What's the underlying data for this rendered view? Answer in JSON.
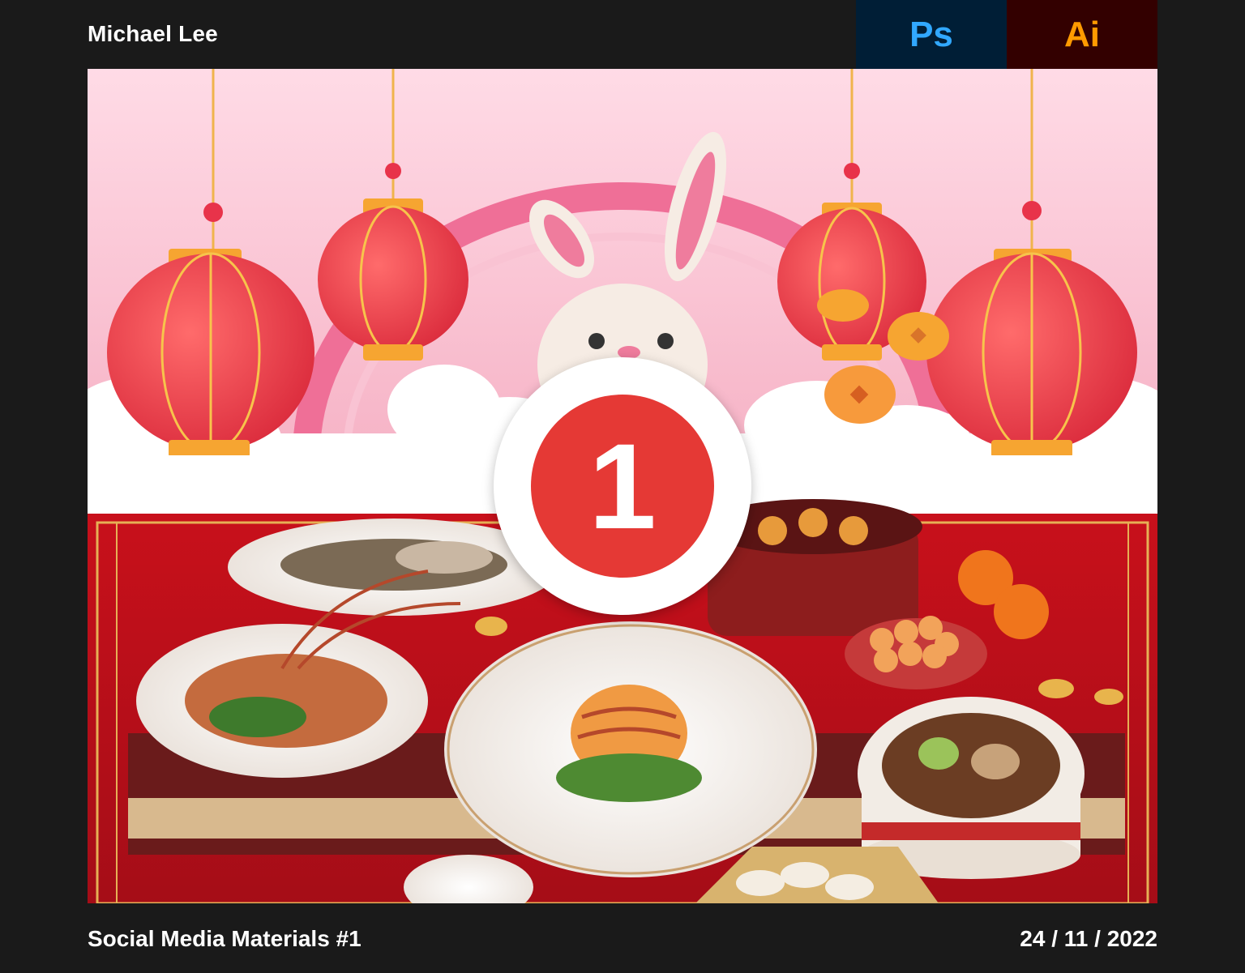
{
  "header": {
    "author": "Michael Lee",
    "badges": [
      {
        "label": "Ps",
        "bg": "#001e36",
        "color": "#31a8ff"
      },
      {
        "label": "Ai",
        "bg": "#330000",
        "color": "#ff9a00"
      }
    ]
  },
  "artwork": {
    "number": "1",
    "accent": "#e53935",
    "top_scene": "pink-lantern-rabbit-scene",
    "bottom_scene": "festive-food-table-photo"
  },
  "footer": {
    "title": "Social Media Materials #1",
    "date": "24 / 11 / 2022"
  }
}
